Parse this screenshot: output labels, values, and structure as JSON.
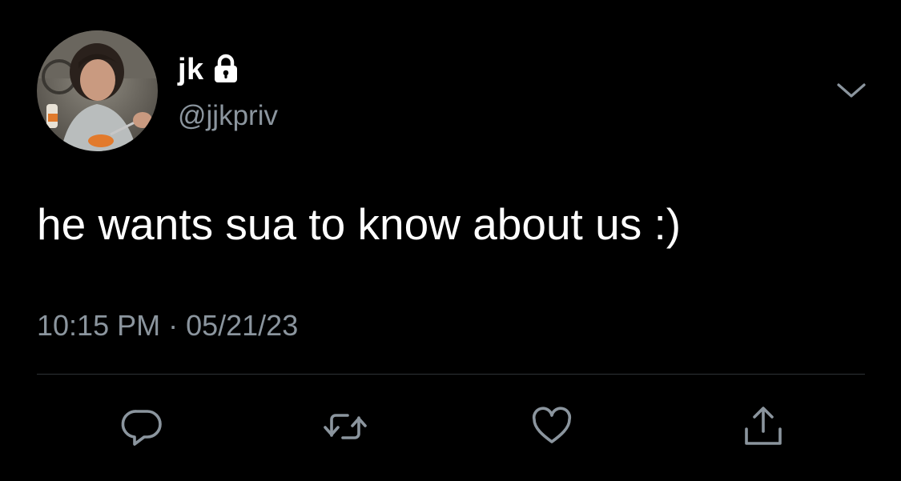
{
  "colors": {
    "background": "#000000",
    "primary_text": "#ffffff",
    "secondary_text": "#8b959e",
    "divider": "#2f3336",
    "icon": "#8b959e"
  },
  "tweet": {
    "author": {
      "display_name": "jk",
      "handle": "@jjkpriv",
      "protected": true,
      "avatar_icon": "profile-photo",
      "lock_icon": "lock-icon"
    },
    "more_icon": "chevron-down-icon",
    "text": "he wants sua to know about us :)",
    "timestamp": "10:15 PM · 05/21/23",
    "actions": [
      {
        "name": "reply",
        "icon": "reply-bubble-icon"
      },
      {
        "name": "retweet",
        "icon": "retweet-icon"
      },
      {
        "name": "like",
        "icon": "heart-icon"
      },
      {
        "name": "share",
        "icon": "share-upload-icon"
      }
    ]
  }
}
